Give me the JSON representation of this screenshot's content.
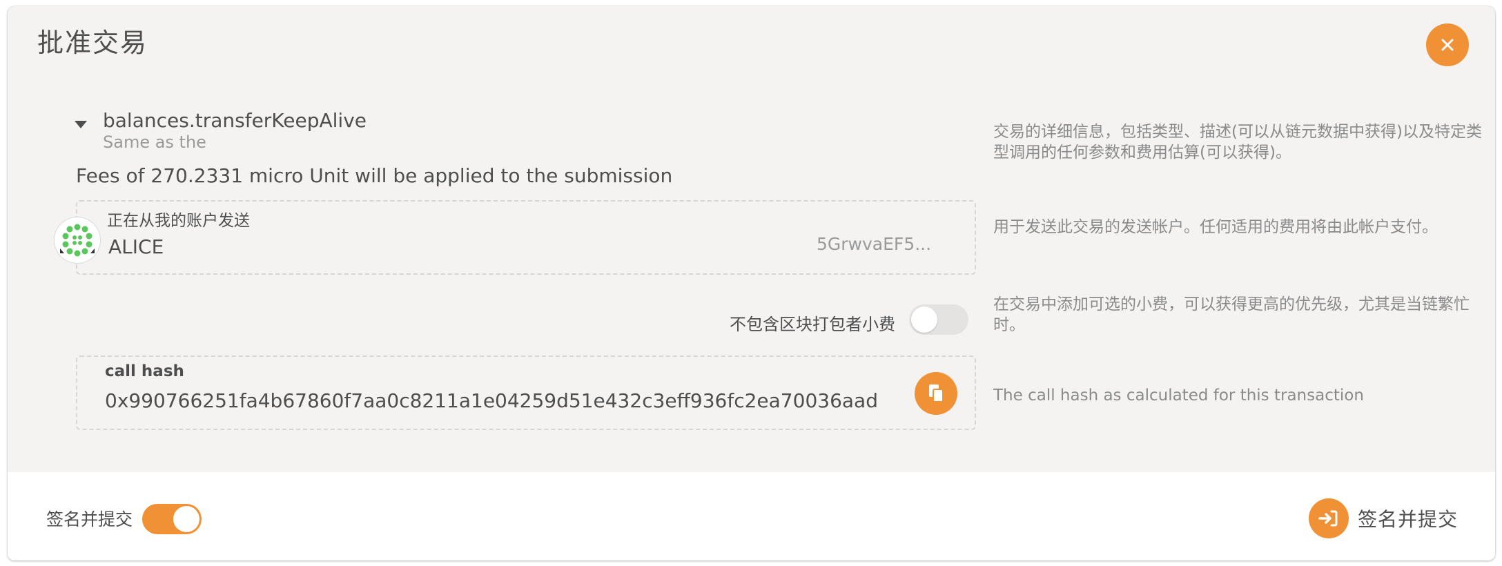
{
  "modal": {
    "title": "批准交易",
    "close_icon": "close-icon"
  },
  "call": {
    "method": "balances.transferKeepAlive",
    "description": "Same as the",
    "fees": "Fees of 270.2331 micro Unit will be applied to the submission",
    "help": "交易的详细信息，包括类型、描述(可以从链元数据中获得)以及特定类型调用的任何参数和费用估算(可以获得)。"
  },
  "sender": {
    "label": "正在从我的账户发送",
    "name": "ALICE",
    "address": "5GrwvaEF5...",
    "help": "用于发送此交易的发送帐户。任何适用的费用将由此帐户支付。"
  },
  "tip": {
    "label": "不包含区块打包者小费",
    "enabled": false,
    "help": "在交易中添加可选的小费，可以获得更高的优先级，尤其是当链繁忙时。"
  },
  "call_hash": {
    "label": "call hash",
    "value": "0x990766251fa4b67860f7aa0c8211a1e04259d51e432c3eff936fc2ea70036aad",
    "help": "The call hash as calculated for this transaction",
    "copy_icon": "copy-icon"
  },
  "footer": {
    "toggle_label": "签名并提交",
    "toggle_enabled": true,
    "submit_label": "签名并提交",
    "submit_icon": "sign-in-icon"
  },
  "colors": {
    "accent": "#f19135",
    "background": "#f4f3f2",
    "text": "#4e4e4e",
    "muted": "#8a8a8a"
  }
}
